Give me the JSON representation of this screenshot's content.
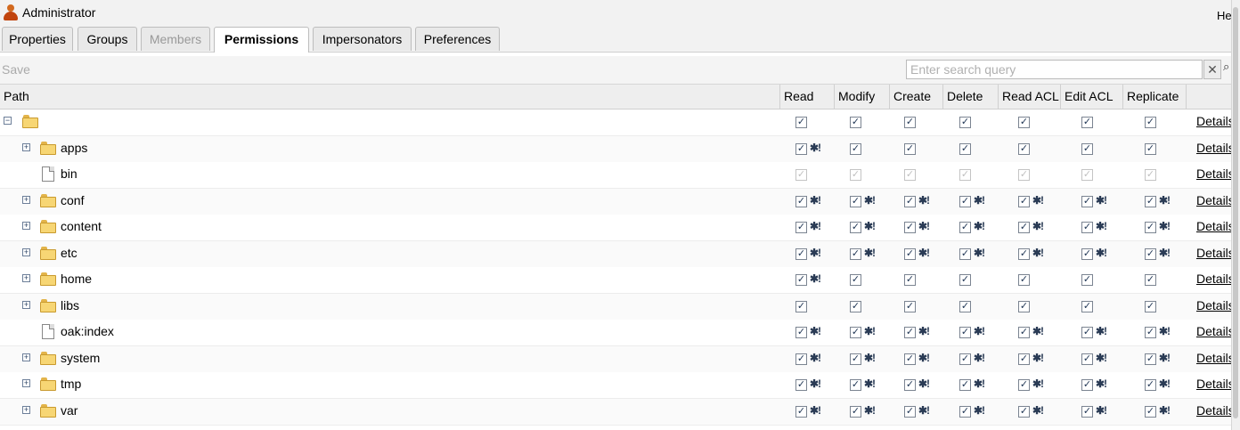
{
  "window": {
    "title": "Administrator",
    "help_label": "He"
  },
  "tabs": [
    {
      "label": "Properties",
      "state": "normal"
    },
    {
      "label": "Groups",
      "state": "normal"
    },
    {
      "label": "Members",
      "state": "disabled"
    },
    {
      "label": "Permissions",
      "state": "active"
    },
    {
      "label": "Impersonators",
      "state": "normal"
    },
    {
      "label": "Preferences",
      "state": "normal"
    }
  ],
  "toolbar": {
    "save_label": "Save",
    "search_placeholder": "Enter search query",
    "clear_label": "✕",
    "search_label": "⌕"
  },
  "table": {
    "columns": [
      "Path",
      "Read",
      "Modify",
      "Create",
      "Delete",
      "Read ACL",
      "Edit ACL",
      "Replicate",
      ""
    ],
    "details_label": "Details",
    "rows": [
      {
        "name": "",
        "icon": "folder-icon",
        "expander": "minus",
        "indent": 0,
        "checked": [
          1,
          1,
          1,
          1,
          1,
          1,
          1
        ],
        "star": [
          0,
          0,
          0,
          0,
          0,
          0,
          0
        ],
        "disabled": false
      },
      {
        "name": "apps",
        "icon": "folder-icon",
        "expander": "plus",
        "indent": 1,
        "checked": [
          1,
          1,
          1,
          1,
          1,
          1,
          1
        ],
        "star": [
          1,
          0,
          0,
          0,
          0,
          0,
          0
        ],
        "disabled": false
      },
      {
        "name": "bin",
        "icon": "file-icon",
        "expander": "none",
        "indent": 1,
        "checked": [
          1,
          1,
          1,
          1,
          1,
          1,
          1
        ],
        "star": [
          0,
          0,
          0,
          0,
          0,
          0,
          0
        ],
        "disabled": true
      },
      {
        "name": "conf",
        "icon": "folder-icon",
        "expander": "plus",
        "indent": 1,
        "checked": [
          1,
          1,
          1,
          1,
          1,
          1,
          1
        ],
        "star": [
          1,
          1,
          1,
          1,
          1,
          1,
          1
        ],
        "disabled": false
      },
      {
        "name": "content",
        "icon": "folder-icon",
        "expander": "plus",
        "indent": 1,
        "checked": [
          1,
          1,
          1,
          1,
          1,
          1,
          1
        ],
        "star": [
          1,
          1,
          1,
          1,
          1,
          1,
          1
        ],
        "disabled": false
      },
      {
        "name": "etc",
        "icon": "folder-icon",
        "expander": "plus",
        "indent": 1,
        "checked": [
          1,
          1,
          1,
          1,
          1,
          1,
          1
        ],
        "star": [
          1,
          1,
          1,
          1,
          1,
          1,
          1
        ],
        "disabled": false
      },
      {
        "name": "home",
        "icon": "folder-icon",
        "expander": "plus",
        "indent": 1,
        "checked": [
          1,
          1,
          1,
          1,
          1,
          1,
          1
        ],
        "star": [
          1,
          0,
          0,
          0,
          0,
          0,
          0
        ],
        "disabled": false
      },
      {
        "name": "libs",
        "icon": "folder-icon",
        "expander": "plus",
        "indent": 1,
        "checked": [
          1,
          1,
          1,
          1,
          1,
          1,
          1
        ],
        "star": [
          0,
          0,
          0,
          0,
          0,
          0,
          0
        ],
        "disabled": false
      },
      {
        "name": "oak:index",
        "icon": "file-icon",
        "expander": "none",
        "indent": 1,
        "checked": [
          1,
          1,
          1,
          1,
          1,
          1,
          1
        ],
        "star": [
          1,
          1,
          1,
          1,
          1,
          1,
          1
        ],
        "disabled": false
      },
      {
        "name": "system",
        "icon": "folder-icon",
        "expander": "plus",
        "indent": 1,
        "checked": [
          1,
          1,
          1,
          1,
          1,
          1,
          1
        ],
        "star": [
          1,
          1,
          1,
          1,
          1,
          1,
          1
        ],
        "disabled": false
      },
      {
        "name": "tmp",
        "icon": "folder-icon",
        "expander": "plus",
        "indent": 1,
        "checked": [
          1,
          1,
          1,
          1,
          1,
          1,
          1
        ],
        "star": [
          1,
          1,
          1,
          1,
          1,
          1,
          1
        ],
        "disabled": false
      },
      {
        "name": "var",
        "icon": "folder-icon",
        "expander": "plus",
        "indent": 1,
        "checked": [
          1,
          1,
          1,
          1,
          1,
          1,
          1
        ],
        "star": [
          1,
          1,
          1,
          1,
          1,
          1,
          1
        ],
        "disabled": false
      }
    ]
  }
}
